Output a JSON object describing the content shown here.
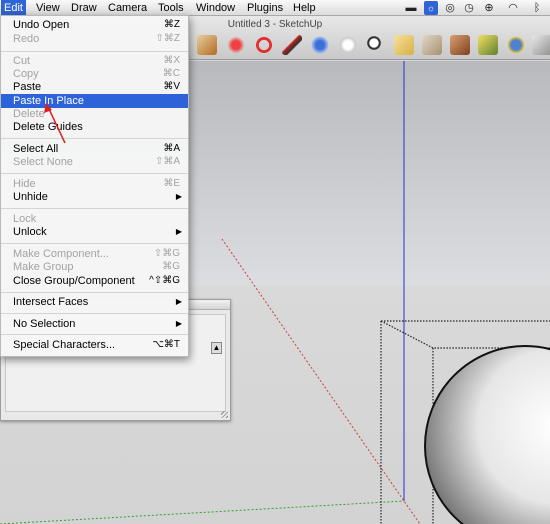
{
  "menubar": {
    "items": [
      "Edit",
      "View",
      "Draw",
      "Camera",
      "Tools",
      "Window",
      "Plugins",
      "Help"
    ]
  },
  "window": {
    "title": "Untitled 3 - SketchUp"
  },
  "edit_menu": {
    "undo": {
      "label": "Undo Open",
      "shortcut": "⌘Z"
    },
    "redo": {
      "label": "Redo",
      "shortcut": "⇧⌘Z"
    },
    "cut": {
      "label": "Cut",
      "shortcut": "⌘X"
    },
    "copy": {
      "label": "Copy",
      "shortcut": "⌘C"
    },
    "paste": {
      "label": "Paste",
      "shortcut": "⌘V"
    },
    "paste_in_place": {
      "label": "Paste In Place"
    },
    "delete": {
      "label": "Delete"
    },
    "delete_guides": {
      "label": "Delete Guides"
    },
    "select_all": {
      "label": "Select All",
      "shortcut": "⌘A"
    },
    "select_none": {
      "label": "Select None",
      "shortcut": "⇧⌘A"
    },
    "hide": {
      "label": "Hide",
      "shortcut": "⌘E"
    },
    "unhide": {
      "label": "Unhide",
      "submenu": "▶"
    },
    "lock": {
      "label": "Lock"
    },
    "unlock": {
      "label": "Unlock",
      "submenu": "▶"
    },
    "make_component": {
      "label": "Make Component...",
      "shortcut": "⇧⌘G"
    },
    "make_group": {
      "label": "Make Group",
      "shortcut": "⌘G"
    },
    "close_group": {
      "label": "Close Group/Component",
      "shortcut": "^⇧⌘G"
    },
    "intersect_faces": {
      "label": "Intersect Faces",
      "submenu": "▶"
    },
    "no_selection": {
      "label": "No Selection",
      "submenu": "▶"
    },
    "special_characters": {
      "label": "Special Characters...",
      "shortcut": "⌥⌘T"
    }
  },
  "panel": {
    "scroll_glyph": "▲"
  },
  "colors": {
    "menu_highlight": "#2d62d8",
    "annotation_arrow": "#e02020",
    "axis_blue": "#2230d8",
    "axis_red": "#c84040",
    "axis_green": "#30a030"
  }
}
